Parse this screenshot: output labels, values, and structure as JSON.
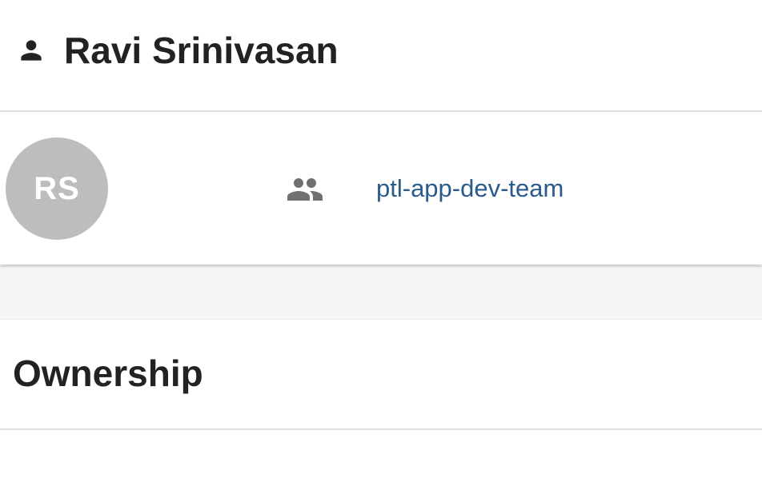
{
  "header": {
    "icon": "person-icon",
    "title": "Ravi Srinivasan"
  },
  "profile": {
    "avatar_initials": "RS",
    "avatar_color": "#bdbdbd",
    "group_icon": "group-icon",
    "team_link": "ptl-app-dev-team",
    "link_color": "#2a5a8c"
  },
  "sections": {
    "ownership_title": "Ownership"
  }
}
